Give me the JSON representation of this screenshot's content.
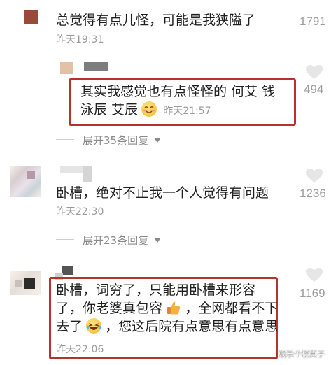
{
  "comments": [
    {
      "text": "总觉得有点儿怪，可能是我狭隘了",
      "time": "昨天19:31",
      "likes": "1791"
    },
    {
      "text_line1": "其实我感觉也有点怪怪的 何艾 钱",
      "text_line2": "泳辰 艾辰",
      "time": "昨天21:57",
      "likes": "494",
      "expand": "展开35条回复"
    },
    {
      "text": "卧槽，绝对不止我一个人觉得有问题",
      "time": "昨天22:30",
      "likes": "1236",
      "expand": "展开23条回复"
    },
    {
      "text_line1": "卧槽，词穷了，只能用卧槽来形容",
      "text_line2a": "了，你老婆真包容",
      "text_line2b": "，全网都看不下",
      "text_line3a": "去了",
      "text_line3b": "，您这后院有点意思有点意思",
      "time": "昨天22:06",
      "likes": "1169"
    }
  ],
  "watermark": "娱乐个橘真子",
  "icons": {
    "like": "heart-outline-icon",
    "expand": "caret-down-icon",
    "emoji_blush": "blushing-smile-emoji-icon",
    "emoji_thumbs": "thumbs-up-emoji-icon",
    "emoji_laugh": "laughing-tears-emoji-icon"
  },
  "colors": {
    "highlight_box": "#b9312c",
    "secondary_text": "#9a9a9a"
  }
}
